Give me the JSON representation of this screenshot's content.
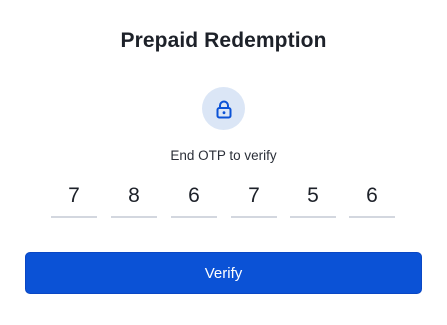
{
  "title": "Prepaid Redemption",
  "icon": "lock-icon",
  "subtitle": "End OTP to verify",
  "otp": {
    "digits": [
      "7",
      "8",
      "6",
      "7",
      "5",
      "6"
    ]
  },
  "verify_button": {
    "label": "Verify"
  },
  "colors": {
    "accent": "#0b52d6",
    "icon_badge": "#dbe6f6",
    "icon": "#0b52d6",
    "otp_underline": "#d3d7df"
  }
}
